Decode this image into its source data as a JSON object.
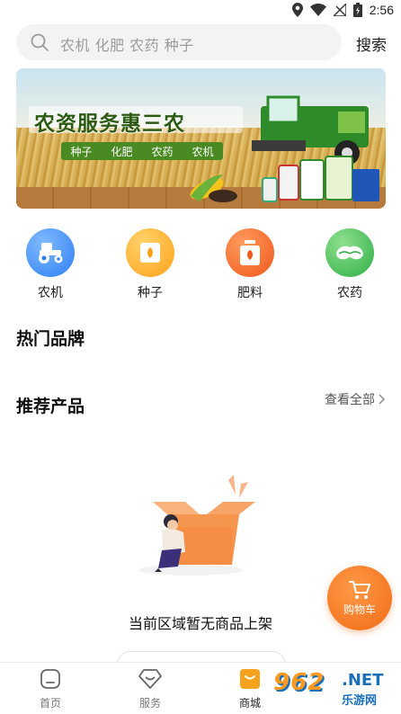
{
  "status_bar": {
    "time": "2:56"
  },
  "search": {
    "placeholder": "农机 化肥 农药 种子",
    "button_label": "搜索"
  },
  "banner": {
    "title": "农资服务惠三农",
    "tags": [
      "种子",
      "化肥",
      "农药",
      "农机"
    ]
  },
  "categories": [
    {
      "label": "农机",
      "icon": "tractor-icon",
      "color": "#3f8ff5"
    },
    {
      "label": "种子",
      "icon": "seed-icon",
      "color": "#ffa726"
    },
    {
      "label": "肥料",
      "icon": "fertilizer-icon",
      "color": "#f2601b"
    },
    {
      "label": "农药",
      "icon": "pesticide-icon",
      "color": "#38b54a"
    }
  ],
  "sections": {
    "hot_brands": "热门品牌",
    "recommended": "推荐产品",
    "view_all": "查看全部"
  },
  "empty_state": {
    "text": "当前区域暂无商品上架"
  },
  "cart_button": {
    "label": "购物车"
  },
  "bottom_nav": {
    "items": [
      {
        "label": "首页",
        "icon": "home-icon"
      },
      {
        "label": "服务",
        "icon": "service-icon"
      },
      {
        "label": "商城",
        "icon": "mall-icon"
      }
    ],
    "active": "商城"
  },
  "watermark": {
    "number": "962",
    "net": ".NET",
    "sub": "乐游网"
  },
  "colors": {
    "accent": "#f58220",
    "blue": "#3f8ff5",
    "green": "#38b54a"
  }
}
